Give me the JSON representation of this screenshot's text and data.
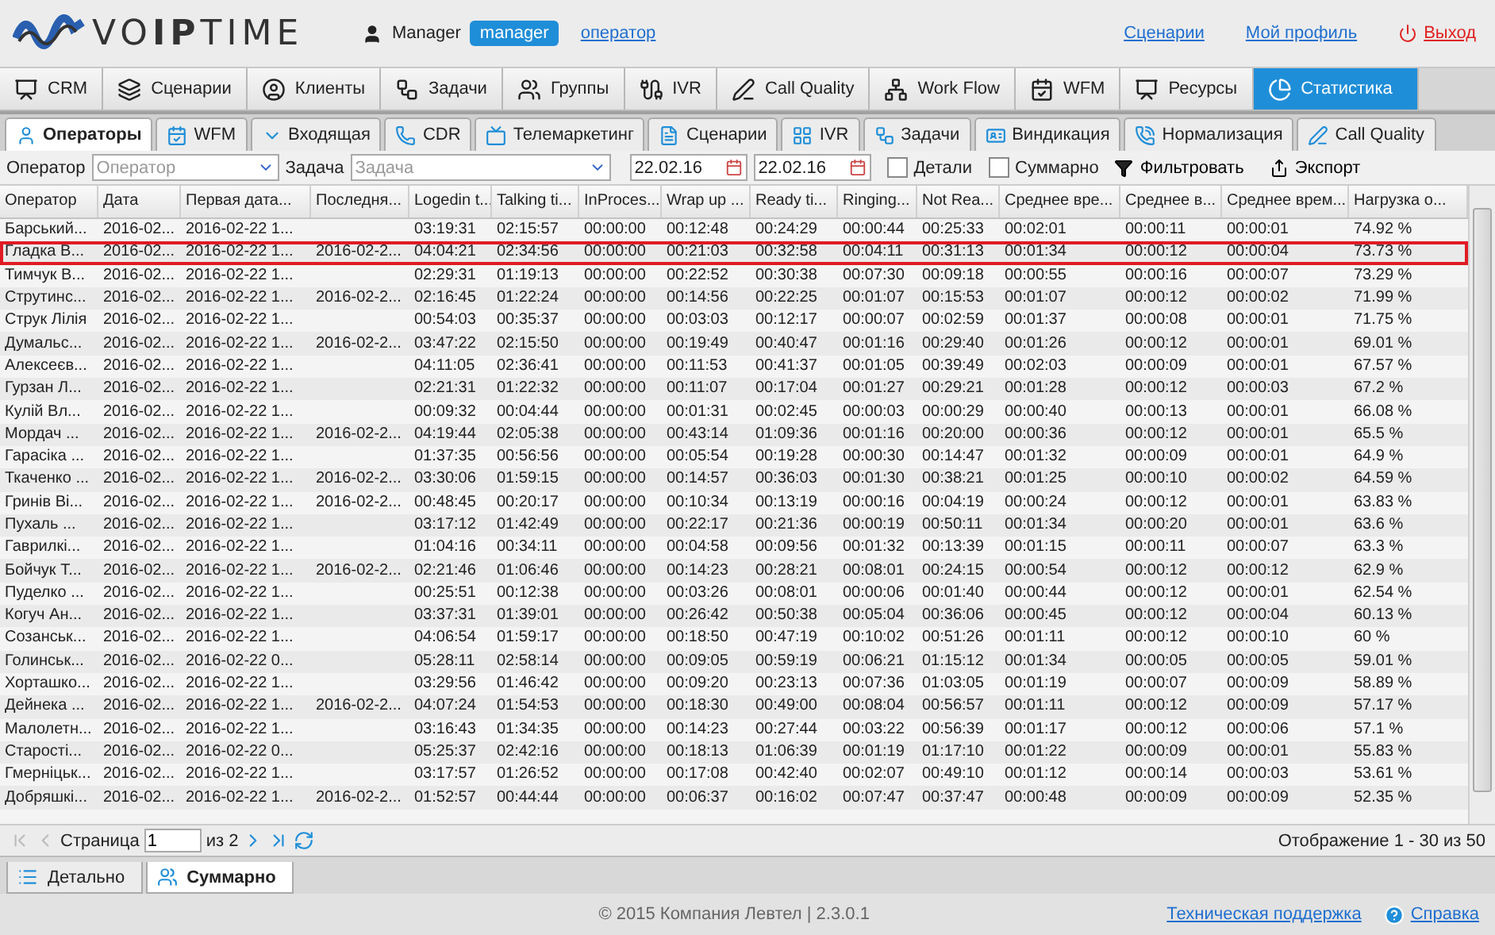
{
  "header": {
    "logo": "VO**IP**TIME",
    "user_name": "Manager",
    "role_badge": "manager",
    "role_link": "оператор",
    "links": [
      {
        "label": "Сценарии",
        "kind": "link"
      },
      {
        "label": "Мой профиль",
        "kind": "link"
      },
      {
        "label": "Выход",
        "kind": "logout"
      }
    ]
  },
  "main_tabs": [
    {
      "label": "CRM",
      "selected": false
    },
    {
      "label": "Сценарии",
      "selected": false
    },
    {
      "label": "Клиенты",
      "selected": false
    },
    {
      "label": "Задачи",
      "selected": false
    },
    {
      "label": "Группы",
      "selected": false
    },
    {
      "label": "IVR",
      "selected": false
    },
    {
      "label": "Call Quality",
      "selected": false
    },
    {
      "label": "Work Flow",
      "selected": false
    },
    {
      "label": "WFM",
      "selected": false
    },
    {
      "label": "Ресурсы",
      "selected": false
    },
    {
      "label": "Статистика",
      "selected": true
    }
  ],
  "sub_tabs": [
    {
      "label": "Операторы",
      "selected": true
    },
    {
      "label": "WFM",
      "selected": false
    },
    {
      "label": "Входящая",
      "selected": false
    },
    {
      "label": "CDR",
      "selected": false
    },
    {
      "label": "Телемаркетинг",
      "selected": false
    },
    {
      "label": "Сценарии",
      "selected": false
    },
    {
      "label": "IVR",
      "selected": false
    },
    {
      "label": "Задачи",
      "selected": false
    },
    {
      "label": "Виндикация",
      "selected": false
    },
    {
      "label": "Нормализация",
      "selected": false
    },
    {
      "label": "Call Quality",
      "selected": false
    }
  ],
  "filters": {
    "operator_label": "Оператор",
    "operator_placeholder": "Оператор",
    "task_label": "Задача",
    "task_placeholder": "Задача",
    "date_from": "22.02.16",
    "date_to": "22.02.16",
    "checkboxes": [
      {
        "label": "Детали",
        "checked": false
      },
      {
        "label": "Суммарно",
        "checked": false
      }
    ],
    "filter_button": "Фильтровать",
    "export_button": "Экспорт"
  },
  "table": {
    "columns": [
      "Оператор",
      "Дата",
      "Первая дата...",
      "Последня...",
      "Logedin t...",
      "Talking ti...",
      "InProces...",
      "Wrap up ...",
      "Ready ti...",
      "Ringing...",
      "Not Rea...",
      "Среднее вре...",
      "Среднее в...",
      "Среднее врем...",
      "Нагрузка о..."
    ],
    "rows": [
      {
        "highlighted": false,
        "cells": [
          "Барський...",
          "2016-02...",
          "2016-02-22 1...",
          null,
          "03:19:31",
          "02:15:57",
          "00:00:00",
          "00:12:48",
          "00:24:29",
          "00:00:44",
          "00:25:33",
          "00:02:01",
          "00:00:11",
          "00:00:01",
          "74.92 %"
        ]
      },
      {
        "highlighted": true,
        "cells": [
          "Гладка В...",
          "2016-02...",
          "2016-02-22 1...",
          "2016-02-2...",
          "04:04:21",
          "02:34:56",
          "00:00:00",
          "00:21:03",
          "00:32:58",
          "00:04:11",
          "00:31:13",
          "00:01:34",
          "00:00:12",
          "00:00:04",
          "73.73 %"
        ]
      },
      {
        "highlighted": false,
        "cells": [
          "Тимчук В...",
          "2016-02...",
          "2016-02-22 1...",
          null,
          "02:29:31",
          "01:19:13",
          "00:00:00",
          "00:22:52",
          "00:30:38",
          "00:07:30",
          "00:09:18",
          "00:00:55",
          "00:00:16",
          "00:00:07",
          "73.29 %"
        ]
      },
      {
        "highlighted": false,
        "cells": [
          "Струтинс...",
          "2016-02...",
          "2016-02-22 1...",
          "2016-02-2...",
          "02:16:45",
          "01:22:24",
          "00:00:00",
          "00:14:56",
          "00:22:25",
          "00:01:07",
          "00:15:53",
          "00:01:07",
          "00:00:12",
          "00:00:02",
          "71.99 %"
        ]
      },
      {
        "highlighted": false,
        "cells": [
          "Струк Лілія",
          "2016-02...",
          "2016-02-22 1...",
          null,
          "00:54:03",
          "00:35:37",
          "00:00:00",
          "00:03:03",
          "00:12:17",
          "00:00:07",
          "00:02:59",
          "00:01:37",
          "00:00:08",
          "00:00:01",
          "71.75 %"
        ]
      },
      {
        "highlighted": false,
        "cells": [
          "Думальс...",
          "2016-02...",
          "2016-02-22 1...",
          "2016-02-2...",
          "03:47:22",
          "02:15:50",
          "00:00:00",
          "00:19:49",
          "00:40:47",
          "00:01:16",
          "00:29:40",
          "00:01:26",
          "00:00:12",
          "00:00:01",
          "69.01 %"
        ]
      },
      {
        "highlighted": false,
        "cells": [
          "Алексеєв...",
          "2016-02...",
          "2016-02-22 1...",
          null,
          "04:11:05",
          "02:36:41",
          "00:00:00",
          "00:11:53",
          "00:41:37",
          "00:01:05",
          "00:39:49",
          "00:02:03",
          "00:00:09",
          "00:00:01",
          "67.57 %"
        ]
      },
      {
        "highlighted": false,
        "cells": [
          "Гурзан Л...",
          "2016-02...",
          "2016-02-22 1...",
          null,
          "02:21:31",
          "01:22:32",
          "00:00:00",
          "00:11:07",
          "00:17:04",
          "00:01:27",
          "00:29:21",
          "00:01:28",
          "00:00:12",
          "00:00:03",
          "67.2 %"
        ]
      },
      {
        "highlighted": false,
        "cells": [
          "Кулій Вл...",
          "2016-02...",
          "2016-02-22 1...",
          null,
          "00:09:32",
          "00:04:44",
          "00:00:00",
          "00:01:31",
          "00:02:45",
          "00:00:03",
          "00:00:29",
          "00:00:40",
          "00:00:13",
          "00:00:01",
          "66.08 %"
        ]
      },
      {
        "highlighted": false,
        "cells": [
          "Мордач ...",
          "2016-02...",
          "2016-02-22 1...",
          "2016-02-2...",
          "04:19:44",
          "02:05:38",
          "00:00:00",
          "00:43:14",
          "01:09:36",
          "00:01:16",
          "00:20:00",
          "00:00:36",
          "00:00:12",
          "00:00:01",
          "65.5 %"
        ]
      },
      {
        "highlighted": false,
        "cells": [
          "Гарасіка ...",
          "2016-02...",
          "2016-02-22 1...",
          null,
          "01:37:35",
          "00:56:56",
          "00:00:00",
          "00:05:54",
          "00:19:28",
          "00:00:30",
          "00:14:47",
          "00:01:32",
          "00:00:09",
          "00:00:01",
          "64.9 %"
        ]
      },
      {
        "highlighted": false,
        "cells": [
          "Ткаченко ...",
          "2016-02...",
          "2016-02-22 1...",
          "2016-02-2...",
          "03:30:06",
          "01:59:15",
          "00:00:00",
          "00:14:57",
          "00:36:03",
          "00:01:30",
          "00:38:21",
          "00:01:25",
          "00:00:10",
          "00:00:02",
          "64.59 %"
        ]
      },
      {
        "highlighted": false,
        "cells": [
          "Гринів Ві...",
          "2016-02...",
          "2016-02-22 1...",
          "2016-02-2...",
          "00:48:45",
          "00:20:17",
          "00:00:00",
          "00:10:34",
          "00:13:19",
          "00:00:16",
          "00:04:19",
          "00:00:24",
          "00:00:12",
          "00:00:01",
          "63.83 %"
        ]
      },
      {
        "highlighted": false,
        "cells": [
          "Пухаль ...",
          "2016-02...",
          "2016-02-22 1...",
          null,
          "03:17:12",
          "01:42:49",
          "00:00:00",
          "00:22:17",
          "00:21:36",
          "00:00:19",
          "00:50:11",
          "00:01:34",
          "00:00:20",
          "00:00:01",
          "63.6 %"
        ]
      },
      {
        "highlighted": false,
        "cells": [
          "Гаврилкі...",
          "2016-02...",
          "2016-02-22 1...",
          null,
          "01:04:16",
          "00:34:11",
          "00:00:00",
          "00:04:58",
          "00:09:56",
          "00:01:32",
          "00:13:39",
          "00:01:15",
          "00:00:11",
          "00:00:07",
          "63.3 %"
        ]
      },
      {
        "highlighted": false,
        "cells": [
          "Бойчук Т...",
          "2016-02...",
          "2016-02-22 1...",
          "2016-02-2...",
          "02:21:46",
          "01:06:46",
          "00:00:00",
          "00:14:23",
          "00:28:21",
          "00:08:01",
          "00:24:15",
          "00:00:54",
          "00:00:12",
          "00:00:12",
          "62.9 %"
        ]
      },
      {
        "highlighted": false,
        "cells": [
          "Пуделко ...",
          "2016-02...",
          "2016-02-22 1...",
          null,
          "00:25:51",
          "00:12:38",
          "00:00:00",
          "00:03:26",
          "00:08:01",
          "00:00:06",
          "00:01:40",
          "00:00:44",
          "00:00:12",
          "00:00:01",
          "62.54 %"
        ]
      },
      {
        "highlighted": false,
        "cells": [
          "Когуч Ан...",
          "2016-02...",
          "2016-02-22 1...",
          null,
          "03:37:31",
          "01:39:01",
          "00:00:00",
          "00:26:42",
          "00:50:38",
          "00:05:04",
          "00:36:06",
          "00:00:45",
          "00:00:12",
          "00:00:04",
          "60.13 %"
        ]
      },
      {
        "highlighted": false,
        "cells": [
          "Созанськ...",
          "2016-02...",
          "2016-02-22 1...",
          null,
          "04:06:54",
          "01:59:17",
          "00:00:00",
          "00:18:50",
          "00:47:19",
          "00:10:02",
          "00:51:26",
          "00:01:11",
          "00:00:12",
          "00:00:10",
          "60 %"
        ]
      },
      {
        "highlighted": false,
        "cells": [
          "Голинськ...",
          "2016-02...",
          "2016-02-22 0...",
          null,
          "05:28:11",
          "02:58:14",
          "00:00:00",
          "00:09:05",
          "00:59:19",
          "00:06:21",
          "01:15:12",
          "00:01:34",
          "00:00:05",
          "00:00:05",
          "59.01 %"
        ]
      },
      {
        "highlighted": false,
        "cells": [
          "Хорташко...",
          "2016-02...",
          "2016-02-22 1...",
          null,
          "03:29:56",
          "01:46:42",
          "00:00:00",
          "00:09:20",
          "00:23:13",
          "00:07:36",
          "01:03:05",
          "00:01:19",
          "00:00:07",
          "00:00:09",
          "58.89 %"
        ]
      },
      {
        "highlighted": false,
        "cells": [
          "Дейнека ...",
          "2016-02...",
          "2016-02-22 1...",
          "2016-02-2...",
          "04:07:24",
          "01:54:53",
          "00:00:00",
          "00:18:30",
          "00:49:00",
          "00:08:04",
          "00:56:57",
          "00:01:11",
          "00:00:12",
          "00:00:09",
          "57.17 %"
        ]
      },
      {
        "highlighted": false,
        "cells": [
          "Малолетн...",
          "2016-02...",
          "2016-02-22 1...",
          null,
          "03:16:43",
          "01:34:35",
          "00:00:00",
          "00:14:23",
          "00:27:44",
          "00:03:22",
          "00:56:39",
          "00:01:17",
          "00:00:12",
          "00:00:06",
          "57.1 %"
        ]
      },
      {
        "highlighted": false,
        "cells": [
          "Старості...",
          "2016-02...",
          "2016-02-22 0...",
          null,
          "05:25:37",
          "02:42:16",
          "00:00:00",
          "00:18:13",
          "01:06:39",
          "00:01:19",
          "01:17:10",
          "00:01:22",
          "00:00:09",
          "00:00:01",
          "55.83 %"
        ]
      },
      {
        "highlighted": false,
        "cells": [
          "Гмерніцьк...",
          "2016-02...",
          "2016-02-22 1...",
          null,
          "03:17:57",
          "01:26:52",
          "00:00:00",
          "00:17:08",
          "00:42:40",
          "00:02:07",
          "00:49:10",
          "00:01:12",
          "00:00:14",
          "00:00:03",
          "53.61 %"
        ]
      },
      {
        "highlighted": false,
        "cells": [
          "Добряшкі...",
          "2016-02...",
          "2016-02-22 1...",
          "2016-02-2...",
          "01:52:57",
          "00:44:44",
          "00:00:00",
          "00:06:37",
          "00:16:02",
          "00:07:47",
          "00:37:47",
          "00:00:48",
          "00:00:09",
          "00:00:09",
          "52.35 %"
        ]
      }
    ]
  },
  "pager": {
    "nav_buttons": [
      {
        "kind": "first",
        "disabled": true
      },
      {
        "kind": "prev",
        "disabled": true
      },
      {
        "kind": "next",
        "disabled": false
      },
      {
        "kind": "last",
        "disabled": false
      }
    ],
    "page_label": "Страница",
    "page": "1",
    "of_total": "из 2",
    "summary": "Отображение 1 - 30 из 50"
  },
  "bottom_tabs": [
    {
      "label": "Детально",
      "selected": false
    },
    {
      "label": "Суммарно",
      "selected": true
    }
  ],
  "footer": {
    "copyright": "© 2015 Компания Левтел | 2.3.0.1",
    "links": [
      "Техническая поддержка",
      "Справка"
    ]
  }
}
